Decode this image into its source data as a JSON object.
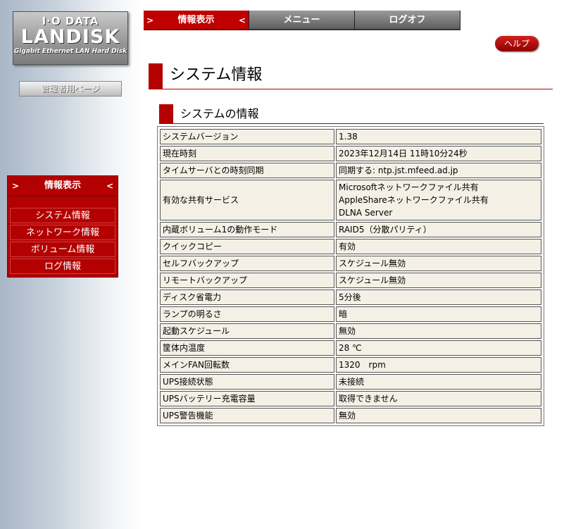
{
  "logo": {
    "line1": "I·O DATA",
    "line2": "LANDISK",
    "line3": "Gigabit Ethernet LAN Hard Disk"
  },
  "sidebar": {
    "admin_button": "管理者用ページ",
    "nav_header": "情報表示",
    "arrow_left": ">",
    "arrow_right": "<",
    "items": [
      {
        "label": "システム情報"
      },
      {
        "label": "ネットワーク情報"
      },
      {
        "label": "ボリューム情報"
      },
      {
        "label": "ログ情報"
      }
    ]
  },
  "topnav": {
    "tabs": [
      {
        "label": "情報表示"
      },
      {
        "label": "メニュー"
      },
      {
        "label": "ログオフ"
      }
    ]
  },
  "help_button": "ヘルプ",
  "page_title": "システム情報",
  "section_title": "システムの情報",
  "rows": [
    {
      "key": "システムバージョン",
      "value": "1.38"
    },
    {
      "key": "現在時刻",
      "value": "2023年12月14日 11時10分24秒"
    },
    {
      "key": "タイムサーバとの時刻同期",
      "value": "同期する: ntp.jst.mfeed.ad.jp"
    },
    {
      "key": "有効な共有サービス",
      "value": "Microsoftネットワークファイル共有\nAppleShareネットワークファイル共有\nDLNA Server"
    },
    {
      "key": "内蔵ボリューム1の動作モード",
      "value": "RAID5（分散パリティ）"
    },
    {
      "key": "クイックコピー",
      "value": "有効"
    },
    {
      "key": "セルフバックアップ",
      "value": "スケジュール無効"
    },
    {
      "key": "リモートバックアップ",
      "value": "スケジュール無効"
    },
    {
      "key": "ディスク省電力",
      "value": "5分後"
    },
    {
      "key": "ランプの明るさ",
      "value": "暗"
    },
    {
      "key": "起動スケジュール",
      "value": "無効"
    },
    {
      "key": "筐体内温度",
      "value": "28 ℃"
    },
    {
      "key": "メインFAN回転数",
      "value": "1320　rpm"
    },
    {
      "key": "UPS接続状態",
      "value": "未接続"
    },
    {
      "key": "UPSバッテリー充電容量",
      "value": "取得できません"
    },
    {
      "key": "UPS警告機能",
      "value": "無効"
    }
  ]
}
